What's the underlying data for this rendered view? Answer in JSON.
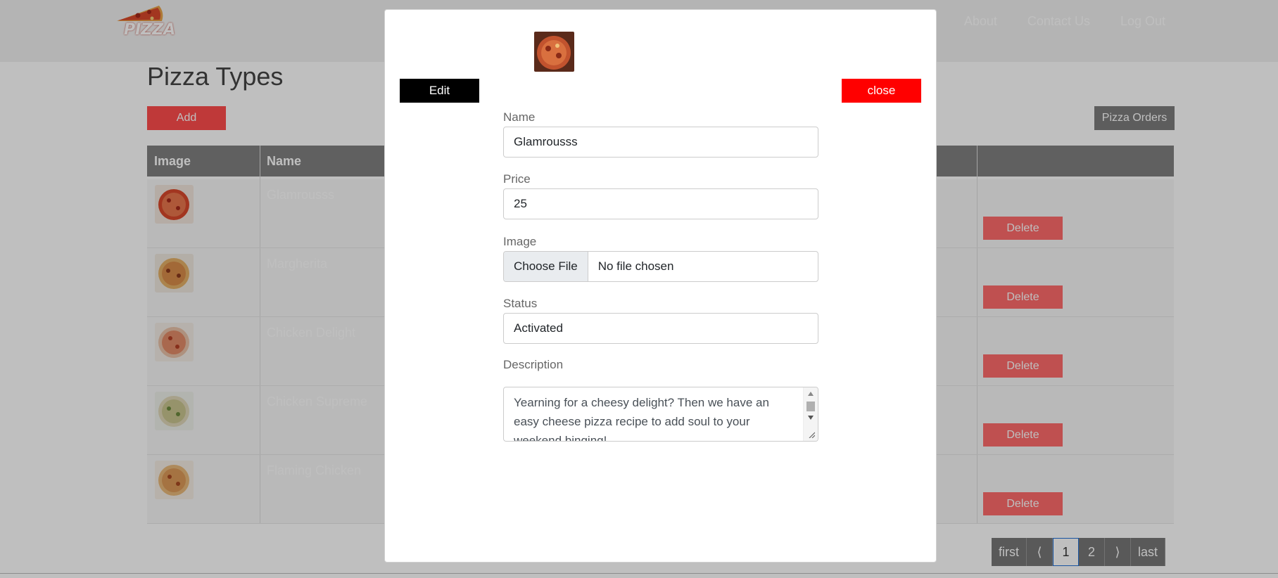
{
  "navbar": {
    "logo_text": "PIZZA",
    "links": [
      "About",
      "Contact Us",
      "Log Out"
    ]
  },
  "page": {
    "title": "Pizza Types",
    "add_label": "Add",
    "orders_label": "Pizza Orders"
  },
  "table": {
    "headers": [
      "Image",
      "Name"
    ],
    "rows": [
      {
        "name": "Glamrousss",
        "delete_label": "Delete"
      },
      {
        "name": "Margherita",
        "delete_label": "Delete"
      },
      {
        "name": "Chicken Delight",
        "delete_label": "Delete"
      },
      {
        "name": "Chicken Supreme",
        "delete_label": "Delete"
      },
      {
        "name": "Flaming Chicken",
        "delete_label": "Delete"
      }
    ]
  },
  "pagination": {
    "first": "first",
    "prev": "⟨",
    "pages": [
      "1",
      "2"
    ],
    "current": "1",
    "next": "⟩",
    "last": "last"
  },
  "modal": {
    "edit_label": "Edit",
    "close_label": "close",
    "fields": {
      "name_label": "Name",
      "name_value": "Glamrousss",
      "price_label": "Price",
      "price_value": "25",
      "image_label": "Image",
      "file_button": "Choose File",
      "file_status": "No file chosen",
      "status_label": "Status",
      "status_value": "Activated",
      "description_label": "Description",
      "description_value": "Yearning for a cheesy delight? Then we have an easy cheese pizza recipe to add soul to your weekend binging!"
    }
  },
  "colors": {
    "primary_red": "#ff0000",
    "edit_black": "#000000",
    "navbar_bg": "#f0f0f0",
    "table_header": "#808080"
  }
}
